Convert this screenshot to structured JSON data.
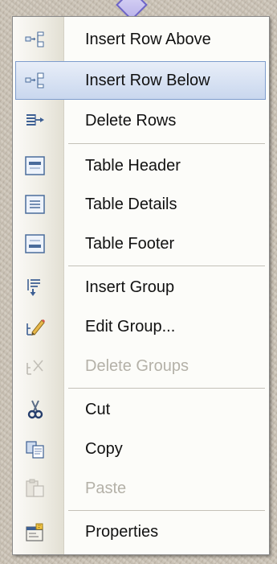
{
  "menu": {
    "items": [
      {
        "label": "Insert Row Above",
        "icon": "insert-row-above-icon",
        "enabled": true,
        "highlighted": false
      },
      {
        "label": "Insert Row Below",
        "icon": "insert-row-below-icon",
        "enabled": true,
        "highlighted": true
      },
      {
        "label": "Delete Rows",
        "icon": "delete-rows-icon",
        "enabled": true,
        "highlighted": false
      },
      {
        "label": "Table Header",
        "icon": "table-header-icon",
        "enabled": true,
        "highlighted": false
      },
      {
        "label": "Table Details",
        "icon": "table-details-icon",
        "enabled": true,
        "highlighted": false
      },
      {
        "label": "Table Footer",
        "icon": "table-footer-icon",
        "enabled": true,
        "highlighted": false
      },
      {
        "label": "Insert Group",
        "icon": "insert-group-icon",
        "enabled": true,
        "highlighted": false
      },
      {
        "label": "Edit Group...",
        "icon": "edit-group-icon",
        "enabled": true,
        "highlighted": false
      },
      {
        "label": "Delete Groups",
        "icon": "delete-groups-icon",
        "enabled": false,
        "highlighted": false
      },
      {
        "label": "Cut",
        "icon": "cut-icon",
        "enabled": true,
        "highlighted": false
      },
      {
        "label": "Copy",
        "icon": "copy-icon",
        "enabled": true,
        "highlighted": false
      },
      {
        "label": "Paste",
        "icon": "paste-icon",
        "enabled": false,
        "highlighted": false
      },
      {
        "label": "Properties",
        "icon": "properties-icon",
        "enabled": true,
        "highlighted": false
      }
    ]
  },
  "colors": {
    "highlight_fill": "#c9d7ee",
    "highlight_border": "#7d9ccd",
    "disabled_text": "#b4b1a8",
    "menu_background": "#fcfcf9",
    "gutter": "#ecebe4"
  }
}
